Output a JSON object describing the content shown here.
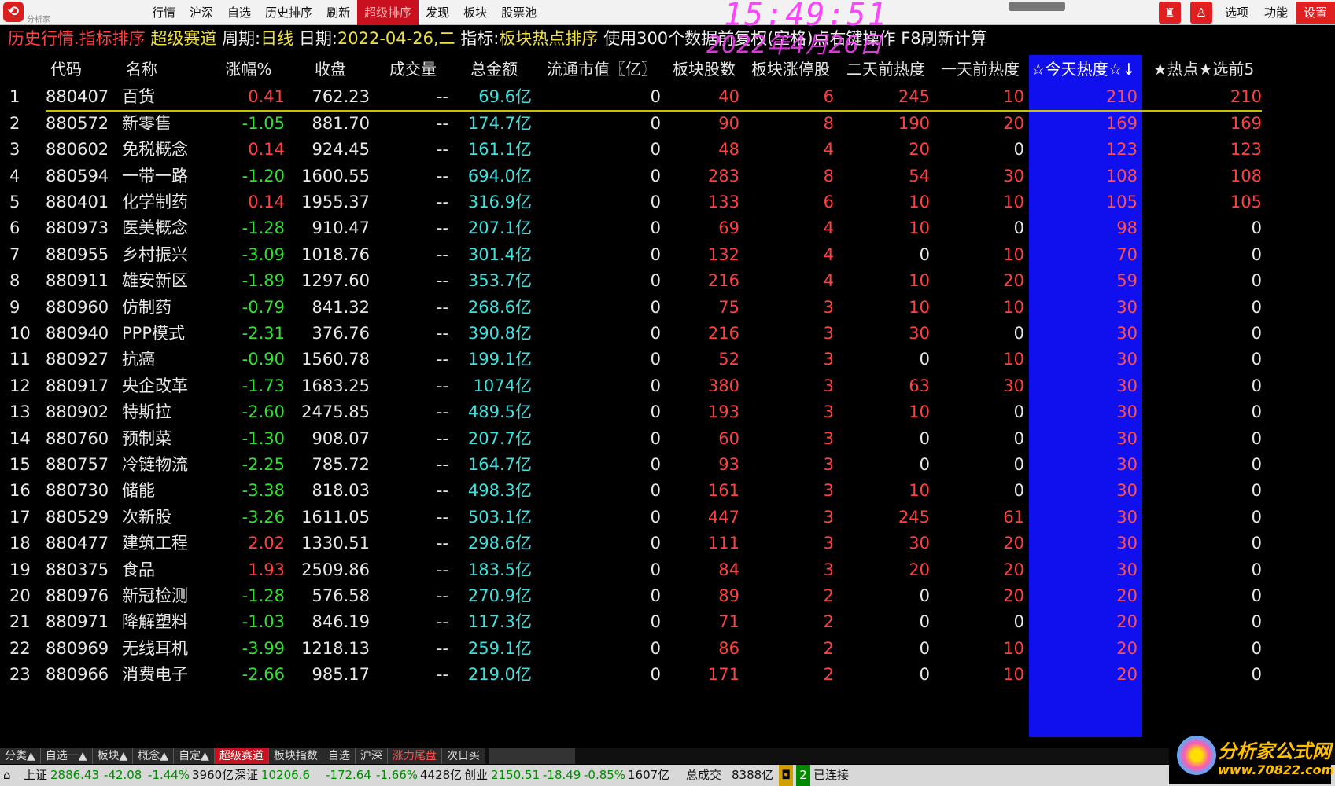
{
  "menubar": {
    "items": [
      "行情",
      "沪深",
      "自选",
      "历史排序",
      "刷新",
      "超级排序",
      "发现",
      "板块",
      "股票池"
    ],
    "active_index": 5,
    "right_items": [
      "选项",
      "功能",
      "设置"
    ],
    "clock": "15:49:51",
    "logo_text": "分析家"
  },
  "titleline": {
    "seg1": "历史行情.指标排序",
    "seg2": "超级赛道",
    "period_label": "周期:",
    "period_value": "日线",
    "date_label": "日期:",
    "date_value": "2022-04-26,二",
    "indicator_label": "指标:",
    "indicator_value": "板块热点排序",
    "note": "使用300个数据前复权(空格)点右键操作 F8刷新计算",
    "date_overlay": "2022年4月26日"
  },
  "table": {
    "headers": {
      "idx": "",
      "code": "代码",
      "name": "名称",
      "chg": "涨幅%",
      "close": "收盘",
      "vol": "成交量",
      "amt": "总金额",
      "mcap": "流通市值〖亿〗",
      "cnt": "板块股数",
      "lim": "板块涨停股",
      "h2": "二天前热度",
      "h1": "一天前热度",
      "h0": "☆今天热度☆↓",
      "top5": "★热点★选前5"
    },
    "rows": [
      {
        "idx": "1",
        "code": "880407",
        "name": "百货",
        "chg": "0.41",
        "close": "762.23",
        "vol": "--",
        "amt": "69.6亿",
        "mcap": "0",
        "cnt": "40",
        "lim": "6",
        "h2": "245",
        "h1": "10",
        "h0": "210",
        "top5": "210"
      },
      {
        "idx": "2",
        "code": "880572",
        "name": "新零售",
        "chg": "-1.05",
        "close": "881.70",
        "vol": "--",
        "amt": "174.7亿",
        "mcap": "0",
        "cnt": "90",
        "lim": "8",
        "h2": "190",
        "h1": "20",
        "h0": "169",
        "top5": "169"
      },
      {
        "idx": "3",
        "code": "880602",
        "name": "免税概念",
        "chg": "0.14",
        "close": "924.45",
        "vol": "--",
        "amt": "161.1亿",
        "mcap": "0",
        "cnt": "48",
        "lim": "4",
        "h2": "20",
        "h1": "0",
        "h0": "123",
        "top5": "123"
      },
      {
        "idx": "4",
        "code": "880594",
        "name": "一带一路",
        "chg": "-1.20",
        "close": "1600.55",
        "vol": "--",
        "amt": "694.0亿",
        "mcap": "0",
        "cnt": "283",
        "lim": "8",
        "h2": "54",
        "h1": "30",
        "h0": "108",
        "top5": "108"
      },
      {
        "idx": "5",
        "code": "880401",
        "name": "化学制药",
        "chg": "0.14",
        "close": "1955.37",
        "vol": "--",
        "amt": "316.9亿",
        "mcap": "0",
        "cnt": "133",
        "lim": "6",
        "h2": "10",
        "h1": "10",
        "h0": "105",
        "top5": "105"
      },
      {
        "idx": "6",
        "code": "880973",
        "name": "医美概念",
        "chg": "-1.28",
        "close": "910.47",
        "vol": "--",
        "amt": "207.1亿",
        "mcap": "0",
        "cnt": "69",
        "lim": "4",
        "h2": "10",
        "h1": "0",
        "h0": "98",
        "top5": "0"
      },
      {
        "idx": "7",
        "code": "880955",
        "name": "乡村振兴",
        "chg": "-3.09",
        "close": "1018.76",
        "vol": "--",
        "amt": "301.4亿",
        "mcap": "0",
        "cnt": "132",
        "lim": "4",
        "h2": "0",
        "h1": "10",
        "h0": "70",
        "top5": "0"
      },
      {
        "idx": "8",
        "code": "880911",
        "name": "雄安新区",
        "chg": "-1.89",
        "close": "1297.60",
        "vol": "--",
        "amt": "353.7亿",
        "mcap": "0",
        "cnt": "216",
        "lim": "4",
        "h2": "10",
        "h1": "20",
        "h0": "59",
        "top5": "0"
      },
      {
        "idx": "9",
        "code": "880960",
        "name": "仿制药",
        "chg": "-0.79",
        "close": "841.32",
        "vol": "--",
        "amt": "268.6亿",
        "mcap": "0",
        "cnt": "75",
        "lim": "3",
        "h2": "10",
        "h1": "10",
        "h0": "30",
        "top5": "0"
      },
      {
        "idx": "10",
        "code": "880940",
        "name": "PPP模式",
        "chg": "-2.31",
        "close": "376.76",
        "vol": "--",
        "amt": "390.8亿",
        "mcap": "0",
        "cnt": "216",
        "lim": "3",
        "h2": "30",
        "h1": "0",
        "h0": "30",
        "top5": "0"
      },
      {
        "idx": "11",
        "code": "880927",
        "name": "抗癌",
        "chg": "-0.90",
        "close": "1560.78",
        "vol": "--",
        "amt": "199.1亿",
        "mcap": "0",
        "cnt": "52",
        "lim": "3",
        "h2": "0",
        "h1": "10",
        "h0": "30",
        "top5": "0"
      },
      {
        "idx": "12",
        "code": "880917",
        "name": "央企改革",
        "chg": "-1.73",
        "close": "1683.25",
        "vol": "--",
        "amt": "1074亿",
        "mcap": "0",
        "cnt": "380",
        "lim": "3",
        "h2": "63",
        "h1": "30",
        "h0": "30",
        "top5": "0"
      },
      {
        "idx": "13",
        "code": "880902",
        "name": "特斯拉",
        "chg": "-2.60",
        "close": "2475.85",
        "vol": "--",
        "amt": "489.5亿",
        "mcap": "0",
        "cnt": "193",
        "lim": "3",
        "h2": "10",
        "h1": "0",
        "h0": "30",
        "top5": "0"
      },
      {
        "idx": "14",
        "code": "880760",
        "name": "预制菜",
        "chg": "-1.30",
        "close": "908.07",
        "vol": "--",
        "amt": "207.7亿",
        "mcap": "0",
        "cnt": "60",
        "lim": "3",
        "h2": "0",
        "h1": "0",
        "h0": "30",
        "top5": "0"
      },
      {
        "idx": "15",
        "code": "880757",
        "name": "冷链物流",
        "chg": "-2.25",
        "close": "785.72",
        "vol": "--",
        "amt": "164.7亿",
        "mcap": "0",
        "cnt": "93",
        "lim": "3",
        "h2": "0",
        "h1": "0",
        "h0": "30",
        "top5": "0"
      },
      {
        "idx": "16",
        "code": "880730",
        "name": "储能",
        "chg": "-3.38",
        "close": "818.03",
        "vol": "--",
        "amt": "498.3亿",
        "mcap": "0",
        "cnt": "161",
        "lim": "3",
        "h2": "10",
        "h1": "0",
        "h0": "30",
        "top5": "0"
      },
      {
        "idx": "17",
        "code": "880529",
        "name": "次新股",
        "chg": "-3.26",
        "close": "1611.05",
        "vol": "--",
        "amt": "503.1亿",
        "mcap": "0",
        "cnt": "447",
        "lim": "3",
        "h2": "245",
        "h1": "61",
        "h0": "30",
        "top5": "0"
      },
      {
        "idx": "18",
        "code": "880477",
        "name": "建筑工程",
        "chg": "2.02",
        "close": "1330.51",
        "vol": "--",
        "amt": "298.6亿",
        "mcap": "0",
        "cnt": "111",
        "lim": "3",
        "h2": "30",
        "h1": "20",
        "h0": "30",
        "top5": "0"
      },
      {
        "idx": "19",
        "code": "880375",
        "name": "食品",
        "chg": "1.93",
        "close": "2509.86",
        "vol": "--",
        "amt": "183.5亿",
        "mcap": "0",
        "cnt": "84",
        "lim": "3",
        "h2": "20",
        "h1": "20",
        "h0": "30",
        "top5": "0"
      },
      {
        "idx": "20",
        "code": "880976",
        "name": "新冠检测",
        "chg": "-1.28",
        "close": "576.58",
        "vol": "--",
        "amt": "270.9亿",
        "mcap": "0",
        "cnt": "89",
        "lim": "2",
        "h2": "0",
        "h1": "20",
        "h0": "20",
        "top5": "0"
      },
      {
        "idx": "21",
        "code": "880971",
        "name": "降解塑料",
        "chg": "-1.03",
        "close": "846.19",
        "vol": "--",
        "amt": "117.3亿",
        "mcap": "0",
        "cnt": "71",
        "lim": "2",
        "h2": "0",
        "h1": "0",
        "h0": "20",
        "top5": "0"
      },
      {
        "idx": "22",
        "code": "880969",
        "name": "无线耳机",
        "chg": "-3.99",
        "close": "1218.13",
        "vol": "--",
        "amt": "259.1亿",
        "mcap": "0",
        "cnt": "86",
        "lim": "2",
        "h2": "0",
        "h1": "10",
        "h0": "20",
        "top5": "0"
      },
      {
        "idx": "23",
        "code": "880966",
        "name": "消费电子",
        "chg": "-2.66",
        "close": "985.17",
        "vol": "--",
        "amt": "219.0亿",
        "mcap": "0",
        "cnt": "171",
        "lim": "2",
        "h2": "0",
        "h1": "10",
        "h0": "20",
        "top5": "0"
      }
    ]
  },
  "bottom_tabs": [
    "分类▲",
    "自选一▲",
    "板块▲",
    "概念▲",
    "自定▲",
    "超级赛道",
    "板块指数",
    "自选",
    "沪深",
    "涨力尾盘",
    "次日买"
  ],
  "bottom_active_index": 5,
  "bottom_red_index": 9,
  "status": {
    "sh_label": "上证",
    "sh_value": "2886.43",
    "sh_chg": "-42.08",
    "sh_pct": "-1.44%",
    "sh_amt": "3960亿",
    "sz_label": "深证",
    "sz_value": "10206.6",
    "sz_chg": "-172.64",
    "sz_pct": "-1.66%",
    "sz_amt": "4428亿",
    "cy_label": "创业",
    "cy_value": "2150.51",
    "cy_chg": "-18.49",
    "cy_pct": "-0.85%",
    "cy_amt": "1607亿",
    "total_label": "总成交",
    "total_value": "8388亿",
    "conn_count": "2",
    "conn_text": "已连接"
  },
  "brand": {
    "name": "分析家公式网",
    "url": "www.70822.com"
  },
  "colors": {
    "up": "#ff4040",
    "down": "#30e030",
    "amount": "#40e0e0",
    "highlight_column": "#1010ee",
    "clock": "#ff44ff"
  }
}
